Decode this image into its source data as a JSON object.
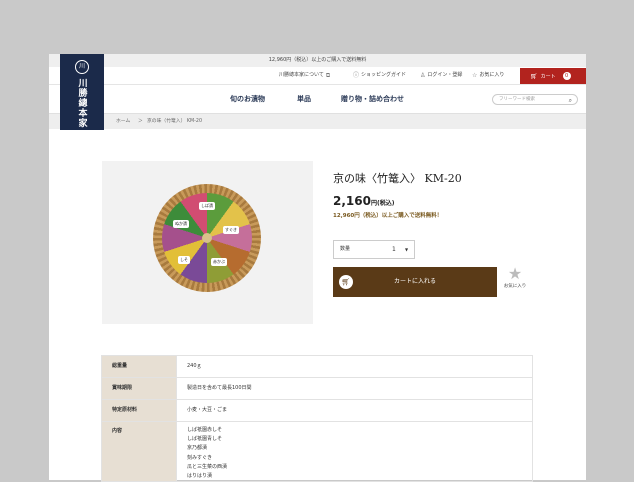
{
  "brand": {
    "mark": "川",
    "name": "川勝總本家"
  },
  "topbar": {
    "text": "12,960円（税込）以上のご購入で送料無料"
  },
  "util": {
    "about": "川勝總本家について",
    "guide": "ショッピングガイド",
    "login": "ログイン・登録",
    "favorites": "お気に入り",
    "cart_label": "カート",
    "cart_count": "0"
  },
  "nav": {
    "items": [
      "旬のお漬物",
      "単品",
      "贈り物・詰め合わせ"
    ],
    "search_placeholder": "フリーワード検索"
  },
  "breadcrumb": {
    "home": "ホーム",
    "sep": "＞",
    "current": "京の味（竹篭入） KM-20"
  },
  "product": {
    "title": "京の味〈竹篭入〉 KM-20",
    "price": "2,160",
    "price_unit": "円(税込)",
    "free_shipping": "12,960円（税込）以上ご購入で送料無料！",
    "qty_label": "数量",
    "qty_value": "1",
    "add_to_cart": "カートに入れる",
    "favorite": "お気に入り",
    "package_labels": [
      "しば漬",
      "すぐき",
      "赤かぶ",
      "しそ",
      "ぬか漬"
    ]
  },
  "spec": {
    "rows": [
      {
        "label": "総重量",
        "value": "240ｇ"
      },
      {
        "label": "賞味期限",
        "value": "製造日を含めて最長100日間"
      },
      {
        "label": "特定原材料",
        "value": "小麦・大豆・ごま"
      }
    ],
    "contents_label": "内容",
    "contents": [
      "しば祇園赤しそ",
      "しば祇園青しそ",
      "京乃都漬",
      "刻みすぐき",
      "瓜と三生菜の西漬",
      "はりはり漬"
    ]
  },
  "colors": {
    "navy": "#1b2a4a",
    "cart_red": "#b2231e",
    "brown": "#5a3a17",
    "spec_header": "#e7dfd3"
  }
}
